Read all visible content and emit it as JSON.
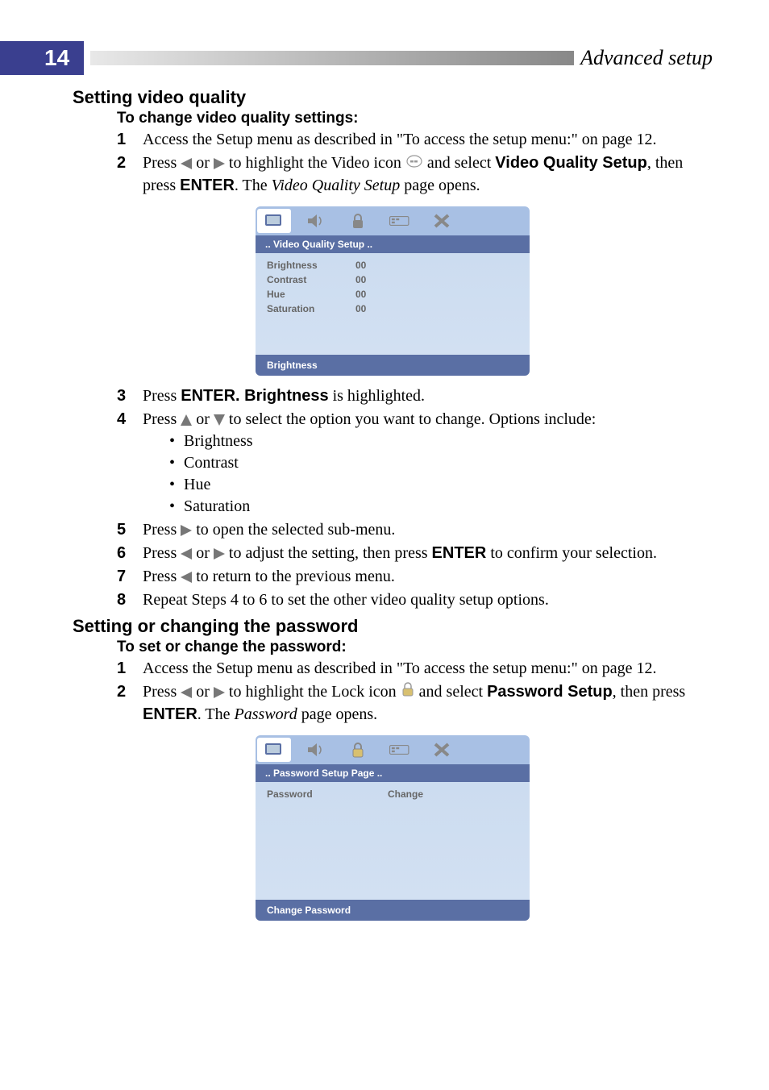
{
  "page_number": "14",
  "header_title": "Advanced setup",
  "section1": {
    "heading": "Setting video quality",
    "subheading": "To change video quality settings:",
    "step1_num": "1",
    "step1_text": "Access the Setup menu as described in \"To access the setup menu:\" on page 12.",
    "step2_num": "2",
    "step2_pre": "Press ",
    "step2_mid1": " or ",
    "step2_mid2": "  to highlight the Video icon ",
    "step2_post1": " and select ",
    "step2_bold1": "Video Quality Setup",
    "step2_post2": ", then press ",
    "step2_bold2": "ENTER",
    "step2_post3": ". The ",
    "step2_italic": "Video Quality Setup",
    "step2_post4": " page opens.",
    "step3_num": "3",
    "step3_pre": "Press ",
    "step3_bold": "ENTER. Brightness",
    "step3_post": " is highlighted.",
    "step4_num": "4",
    "step4_pre": "Press ",
    "step4_mid": " or ",
    "step4_post": "  to select the option you want to change. Options include:",
    "bullets": [
      "Brightness",
      "Contrast",
      "Hue",
      "Saturation"
    ],
    "step5_num": "5",
    "step5_pre": "Press ",
    "step5_post": "  to open the selected sub-menu.",
    "step6_num": "6",
    "step6_pre": "Press ",
    "step6_mid1": " or ",
    "step6_mid2": "  to adjust the setting, then press ",
    "step6_bold": "ENTER",
    "step6_post": " to confirm your selection.",
    "step7_num": "7",
    "step7_pre": "Press ",
    "step7_post": "  to return to the previous menu.",
    "step8_num": "8",
    "step8_text": "Repeat Steps 4 to 6 to set the other video quality setup options."
  },
  "osd1": {
    "title": "..   Video  Quality  Setup    ..",
    "rows": [
      {
        "label": "Brightness",
        "value": "00"
      },
      {
        "label": "Contrast",
        "value": "00"
      },
      {
        "label": "Hue",
        "value": "00"
      },
      {
        "label": "Saturation",
        "value": "00"
      }
    ],
    "footer": "Brightness"
  },
  "section2": {
    "heading": "Setting or changing the password",
    "subheading": "To set or change the password:",
    "step1_num": "1",
    "step1_text": "Access the Setup menu as described in \"To access the setup menu:\" on page 12.",
    "step2_num": "2",
    "step2_pre": "Press ",
    "step2_mid1": " or ",
    "step2_mid2": "  to highlight the Lock icon ",
    "step2_post1": " and select ",
    "step2_bold1": "Password Setup",
    "step2_post2": ", then press ",
    "step2_bold2": "ENTER",
    "step2_post3": ". The ",
    "step2_italic": "Password",
    "step2_post4": " page opens."
  },
  "osd2": {
    "title": "..   Password Setup   Page   ..",
    "row_label": "Password",
    "row_value": "Change",
    "footer": "Change Password"
  }
}
